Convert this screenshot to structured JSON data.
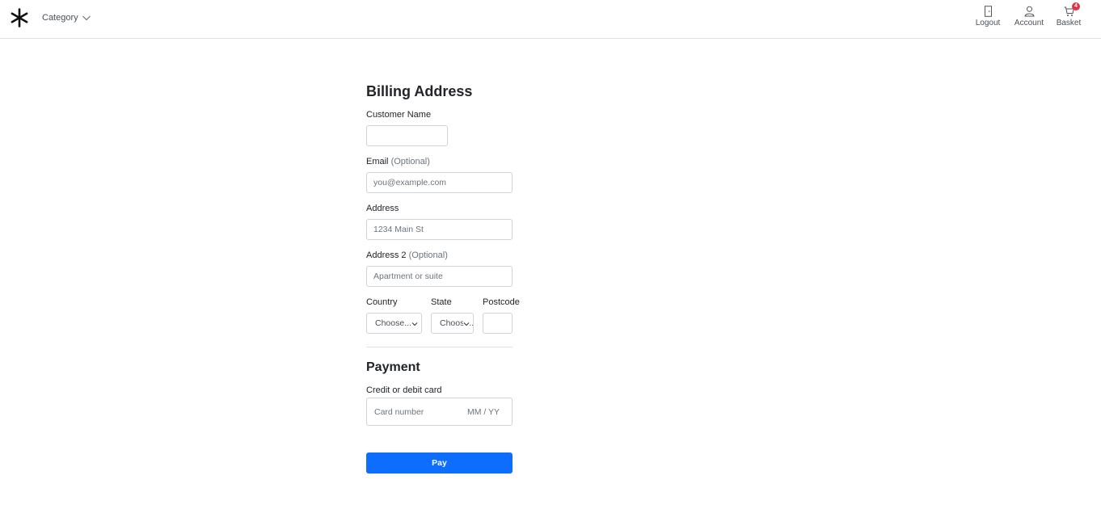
{
  "header": {
    "category_label": "Category",
    "nav": {
      "logout": "Logout",
      "account": "Account",
      "basket": "Basket",
      "basket_count": "4"
    }
  },
  "billing": {
    "title": "Billing Address",
    "customer_name_label": "Customer Name",
    "customer_name_value": "",
    "email_label": "Email",
    "email_optional": "(Optional)",
    "email_placeholder": "you@example.com",
    "address_label": "Address",
    "address_placeholder": "1234 Main St",
    "address2_label": "Address 2",
    "address2_optional": "(Optional)",
    "address2_placeholder": "Apartment or suite",
    "country_label": "Country",
    "country_value": "Choose...",
    "state_label": "State",
    "state_value": "Choose...",
    "postcode_label": "Postcode",
    "postcode_value": ""
  },
  "payment": {
    "title": "Payment",
    "card_label": "Credit or debit card",
    "card_number_placeholder": "Card number",
    "expiry_placeholder": "MM / YY",
    "pay_label": "Pay"
  },
  "colors": {
    "primary": "#0d6efd",
    "badge": "#dc3545",
    "border": "#ced4da"
  }
}
